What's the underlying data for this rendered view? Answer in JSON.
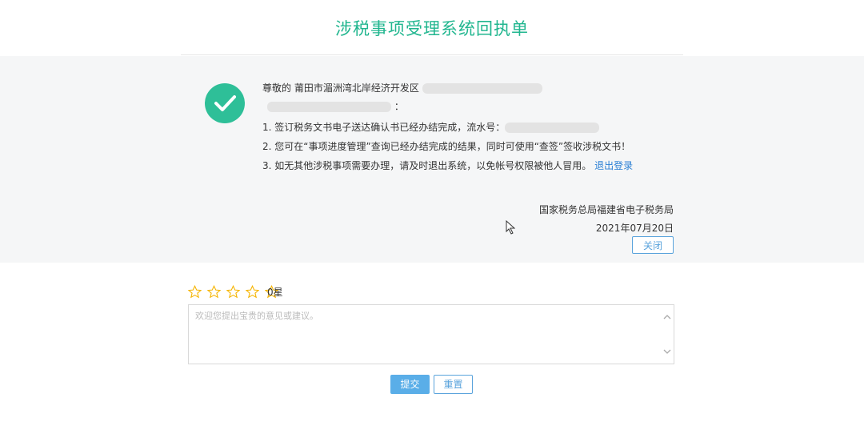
{
  "header": {
    "title": "涉税事项受理系统回执单"
  },
  "receipt": {
    "greeting_prefix": "尊敬的",
    "org_name": "莆田市湄洲湾北岸经济开发区",
    "colon": "：",
    "items": [
      {
        "text": "1. 签订税务文书电子送达确认书已经办结完成，流水号："
      },
      {
        "text": "2. 您可在“事项进度管理”查询已经办结完成的结果，同时可使用“查签”签收涉税文书！"
      },
      {
        "text": "3. 如无其他涉税事项需要办理，请及时退出系统，以免帐号权限被他人冒用。"
      }
    ],
    "logout_link": "退出登录",
    "issuer": "国家税务总局福建省电子税务局",
    "date": "2021年07月20日",
    "close_label": "关闭"
  },
  "rating": {
    "label": "0星",
    "value": 0,
    "max": 5,
    "star_color": "#f5b400"
  },
  "feedback": {
    "placeholder": "欢迎您提出宝贵的意见或建议。",
    "value": ""
  },
  "actions": {
    "submit_label": "提交",
    "reset_label": "重置"
  },
  "colors": {
    "brand": "#21b68f",
    "check": "#2ebf98",
    "link": "#2a7fd4",
    "primary_button": "#5aaee8"
  }
}
